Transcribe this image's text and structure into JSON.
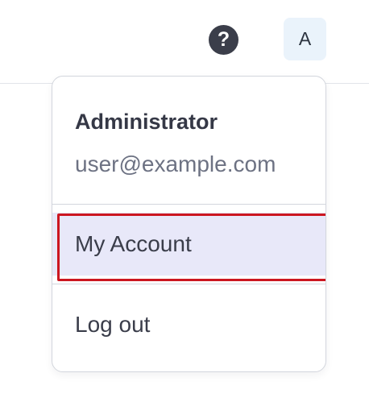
{
  "header": {
    "help_icon_glyph": "?",
    "avatar_initial": "A"
  },
  "user_menu": {
    "name": "Administrator",
    "email": "user@example.com",
    "items": [
      {
        "label": "My Account",
        "highlighted": true
      },
      {
        "label": "Log out",
        "highlighted": false
      }
    ]
  },
  "colors": {
    "highlight_border": "#cc1620",
    "highlight_background": "#e8e8f9",
    "avatar_background": "#eaf3fb",
    "help_icon_background": "#3b3e4a"
  }
}
